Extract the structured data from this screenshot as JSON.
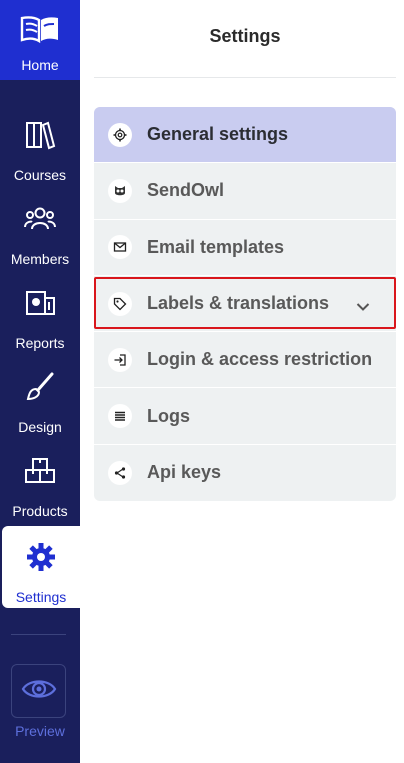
{
  "sidebar": {
    "home_label": "Home",
    "items": [
      {
        "label": "Courses"
      },
      {
        "label": "Members"
      },
      {
        "label": "Reports"
      },
      {
        "label": "Design"
      },
      {
        "label": "Products"
      },
      {
        "label": "Settings"
      }
    ],
    "preview_label": "Preview",
    "active_item": "Settings"
  },
  "page": {
    "title": "Settings"
  },
  "menu": {
    "items": [
      {
        "label": "General settings",
        "icon": "gear-icon"
      },
      {
        "label": "SendOwl",
        "icon": "owl-icon"
      },
      {
        "label": "Email templates",
        "icon": "envelope-icon"
      },
      {
        "label": "Labels & translations",
        "icon": "tag-icon"
      },
      {
        "label": "Login & access restriction",
        "icon": "login-icon"
      },
      {
        "label": "Logs",
        "icon": "list-icon"
      },
      {
        "label": "Api keys",
        "icon": "network-icon"
      }
    ],
    "active_item": "General settings",
    "highlighted_item": "Labels & translations"
  },
  "colors": {
    "rail_bg": "#1a1f5c",
    "accent": "#1f2fd0",
    "active_menu_bg": "#c9ccf0",
    "highlight": "#d9161c"
  }
}
